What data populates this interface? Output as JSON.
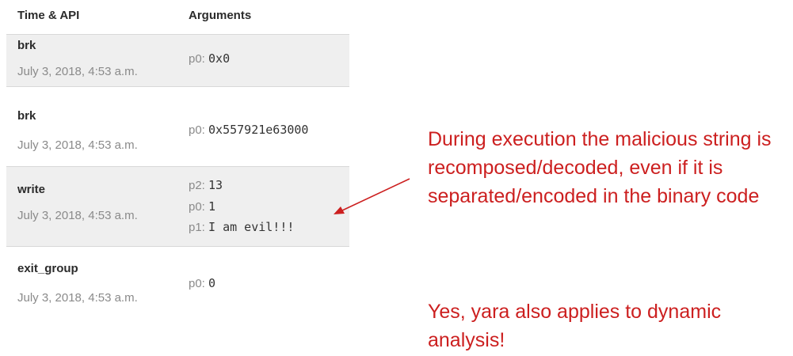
{
  "table": {
    "headers": {
      "time_api": "Time & API",
      "arguments": "Arguments"
    },
    "rows": [
      {
        "api": "brk",
        "timestamp": "July 3, 2018, 4:53 a.m.",
        "args": [
          {
            "key": "p0:",
            "value": "0x0"
          }
        ]
      },
      {
        "api": "brk",
        "timestamp": "July 3, 2018, 4:53 a.m.",
        "args": [
          {
            "key": "p0:",
            "value": "0x557921e63000"
          }
        ]
      },
      {
        "api": "write",
        "timestamp": "July 3, 2018, 4:53 a.m.",
        "args": [
          {
            "key": "p2:",
            "value": "13"
          },
          {
            "key": "p0:",
            "value": "1"
          },
          {
            "key": "p1:",
            "value": "I am evil!!!"
          }
        ]
      },
      {
        "api": "exit_group",
        "timestamp": "July 3, 2018, 4:53 a.m.",
        "args": [
          {
            "key": "p0:",
            "value": "0"
          }
        ]
      }
    ]
  },
  "annotations": {
    "note1": "During execution the malicious string is recomposed/decoded, even if it is separated/encoded in the binary code",
    "note2": "Yes, yara also applies to dynamic analysis!"
  },
  "colors": {
    "annotation": "#cc1f1f",
    "row_shade": "#efefef"
  }
}
